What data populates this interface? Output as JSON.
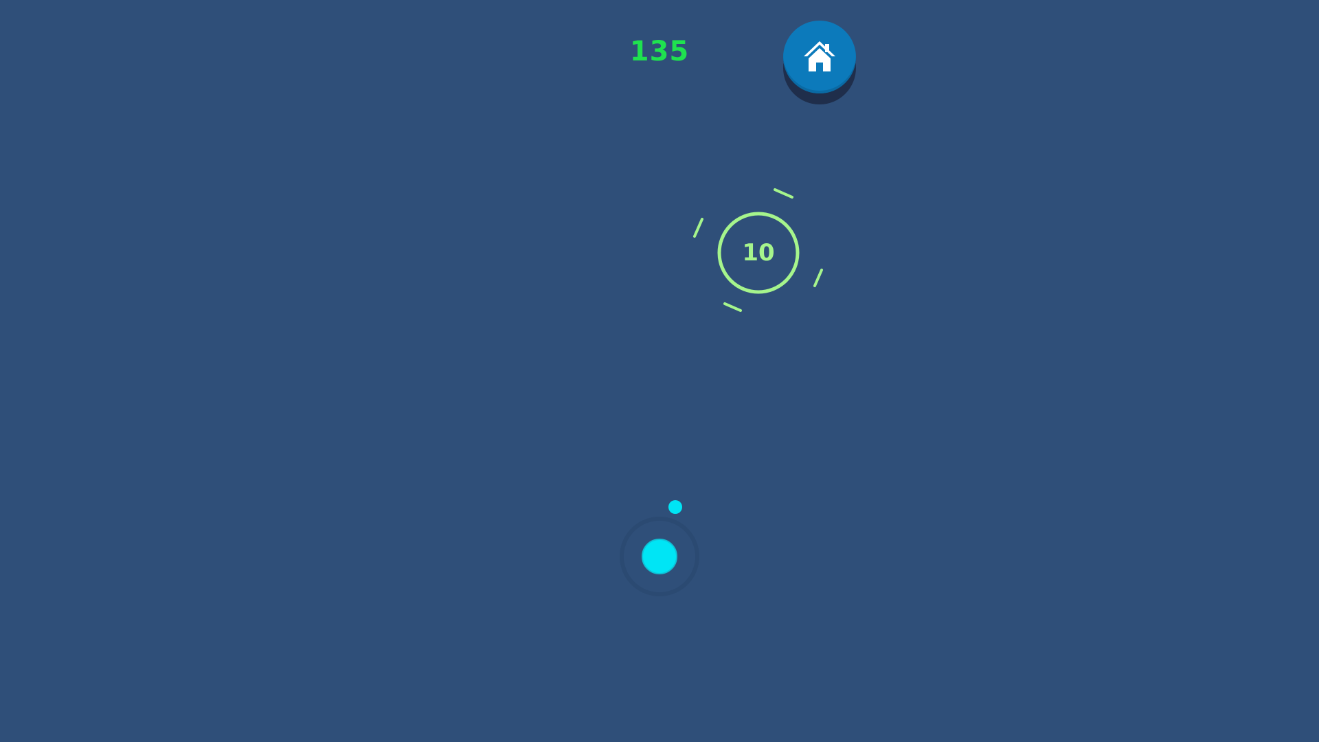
{
  "hud": {
    "score": "135",
    "score_color": "#1fe24f"
  },
  "home_button": {
    "icon": "home-icon",
    "color": "#0c7abb"
  },
  "target": {
    "value": "10",
    "color": "#a6f58c",
    "icon": "ring-target"
  },
  "player": {
    "color": "#00e5f5",
    "icon": "orb-player"
  },
  "colors": {
    "background": "#2f4f79",
    "player_ring": "#2b4a72"
  }
}
